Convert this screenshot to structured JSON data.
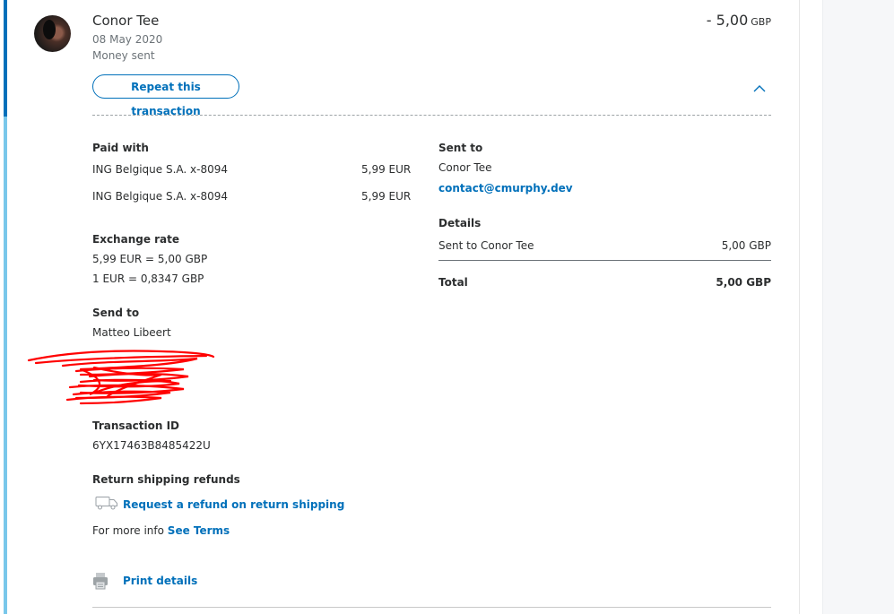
{
  "header": {
    "name": "Conor Tee",
    "date": "08 May 2020",
    "status": "Money sent",
    "amount": "- 5,00",
    "currency": "GBP",
    "repeat_label": "Repeat this transaction"
  },
  "paid_with": {
    "heading": "Paid with",
    "rows": [
      {
        "source": "ING Belgique S.A. x-8094",
        "amount": "5,99 EUR"
      },
      {
        "source": "ING Belgique S.A. x-8094",
        "amount": "5,99 EUR"
      }
    ]
  },
  "exchange": {
    "heading": "Exchange rate",
    "line1": "5,99 EUR = 5,00 GBP",
    "line2": "1 EUR = 0,8347 GBP"
  },
  "send_to": {
    "heading": "Send to",
    "name": "Matteo Libeert"
  },
  "transaction": {
    "heading": "Transaction ID",
    "id": "6YX17463B8485422U"
  },
  "refunds": {
    "heading": "Return shipping refunds",
    "link": "Request a refund on return shipping",
    "more_prefix": "For more info",
    "terms_link": "See Terms"
  },
  "print_label": "Print details",
  "sent_to": {
    "heading": "Sent to",
    "name": "Conor Tee",
    "email": "contact@cmurphy.dev"
  },
  "details": {
    "heading": "Details",
    "row_label": "Sent to Conor Tee",
    "row_value": "5,00 GBP",
    "total_label": "Total",
    "total_value": "5,00 GBP"
  },
  "colors": {
    "accent": "#0070ba",
    "accent_light": "#79c7ea",
    "redaction": "#ff0000"
  },
  "icons": [
    "chevron-up-icon",
    "truck-icon",
    "printer-icon"
  ]
}
